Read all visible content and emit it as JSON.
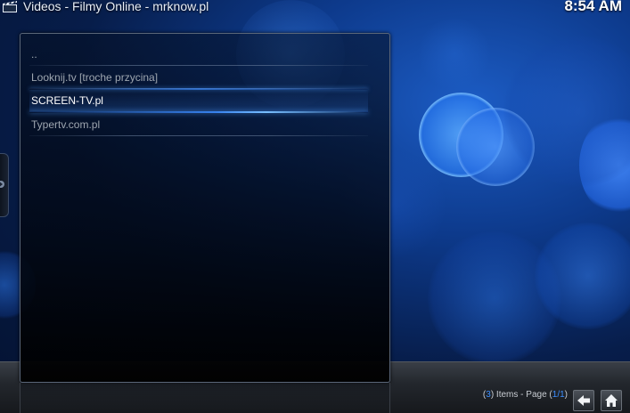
{
  "header": {
    "title": "Videos - Filmy Online - mrknow.pl",
    "clock": "8:54 AM",
    "icon": "clapperboard-icon"
  },
  "list": {
    "items": [
      {
        "label": "..",
        "selected": false
      },
      {
        "label": "Looknij.tv [troche przycina]",
        "selected": false
      },
      {
        "label": "SCREEN-TV.pl",
        "selected": true
      },
      {
        "label": "Typertv.com.pl",
        "selected": false
      }
    ]
  },
  "footer": {
    "count": "3",
    "items_page_text": " Items - Page ",
    "page_current": "1",
    "page_total": "1",
    "back_icon": "back-arrow-icon",
    "home_icon": "home-icon"
  },
  "colors": {
    "accent": "#3d8fff",
    "background": "#05122b"
  }
}
